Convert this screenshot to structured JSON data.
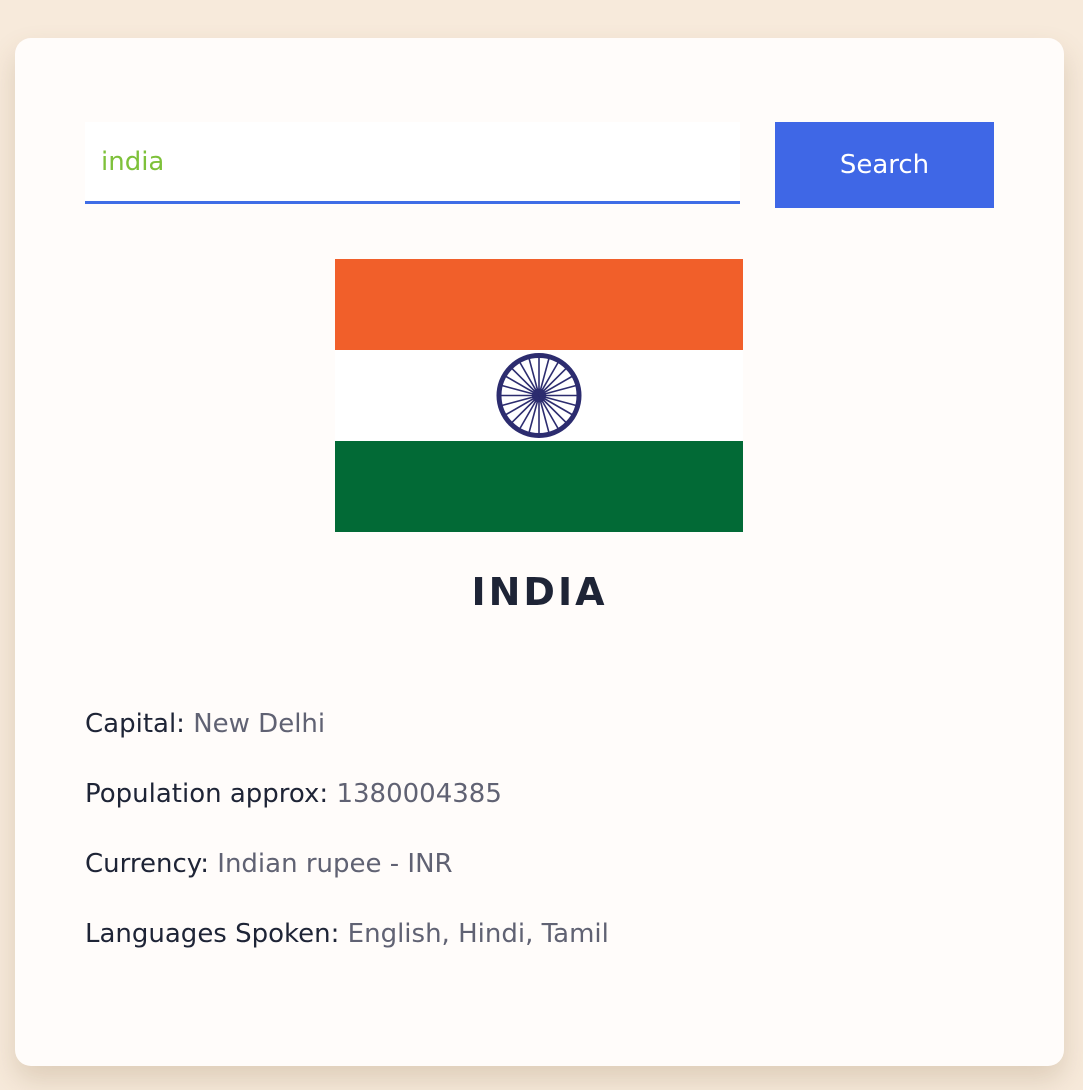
{
  "search": {
    "value": "india",
    "button_label": "Search"
  },
  "flag": {
    "icon": "india-flag-icon",
    "colors": {
      "saffron": "#f15f2a",
      "white": "#ffffff",
      "green": "#026a36",
      "chakra": "#2c2c6f"
    }
  },
  "country": {
    "name": "INDIA"
  },
  "info": {
    "capital_label": "Capital:",
    "capital_value": "New Delhi",
    "population_label": "Population approx:",
    "population_value": "1380004385",
    "currency_label": "Currency:",
    "currency_value": "Indian rupee - INR",
    "languages_label": "Languages Spoken:",
    "languages_value": "English, Hindi, Tamil"
  },
  "colors": {
    "page_background": "#f7eadb",
    "card_background": "#fffcfa",
    "accent": "#3f67e6",
    "input_text": "#7ec13a",
    "heading_text": "#1e2436",
    "value_text": "#606273"
  }
}
